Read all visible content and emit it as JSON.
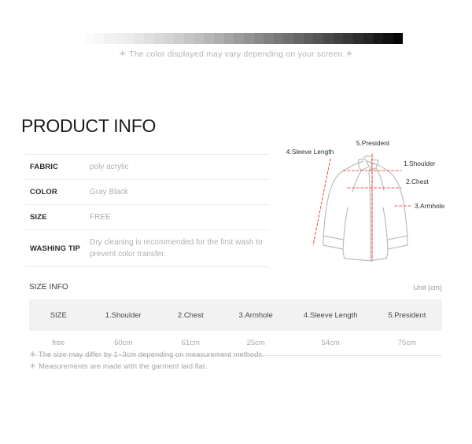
{
  "colorbar": {
    "note": "＊ The color displayed may vary depending on your screen.＊",
    "swatches": [
      "#ffffff",
      "#fbfbfb",
      "#f7f7f7",
      "#f2f2f2",
      "#efefef",
      "#ececec",
      "#e6e6e6",
      "#e0e0e0",
      "#dadada",
      "#d4d4d4",
      "#cdcdcd",
      "#c6c6c6",
      "#bfbfbf",
      "#b7b7b7",
      "#aeaeae",
      "#a5a5a5",
      "#9c9c9c",
      "#939393",
      "#8a8a8a",
      "#818181",
      "#787878",
      "#6f6f6f",
      "#666666",
      "#5d5d5d",
      "#545454",
      "#4a4a4a",
      "#414141",
      "#383838",
      "#2e2e2e",
      "#252525",
      "#1a1a1a",
      "#101010",
      "#050505"
    ]
  },
  "product_info": {
    "title": "PRODUCT INFO",
    "rows": [
      {
        "label": "FABRIC",
        "value": "poly acrylic"
      },
      {
        "label": "COLOR",
        "value": "Gray Black"
      },
      {
        "label": "SIZE",
        "value": "FREE"
      },
      {
        "label": "WASHING TIP",
        "value": "Dry cleaning is recommended for the first wash to prevent color transfer."
      }
    ]
  },
  "diagram": {
    "labels": {
      "president": "5.President",
      "sleeve_length": "4.Sleeve Length",
      "shoulder": "1.Shoulder",
      "chest": "2.Chest",
      "armhole": "3.Armhole"
    },
    "colors": {
      "outline": "#bdbdbd",
      "measure_line": "#f4544f"
    }
  },
  "size_info": {
    "label": "SIZE INFO",
    "unit": "Unit (cm)",
    "columns": [
      "SIZE",
      "1.Shoulder",
      "2.Chest",
      "3.Armhole",
      "4.Sleeve Length",
      "5.President"
    ],
    "rows": [
      [
        "free",
        "60cm",
        "61cm",
        "25cm",
        "54cm",
        "75cm"
      ]
    ],
    "notes": [
      "＊ The size may differ by 1~3cm depending on measurement methods.",
      "＊ Measurements are made with the garment laid flat."
    ]
  }
}
